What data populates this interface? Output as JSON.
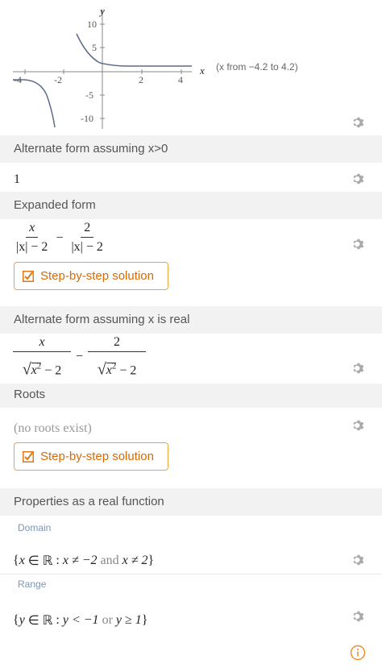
{
  "plot": {
    "x_axis_label": "x",
    "y_axis_label": "y",
    "x_ticks": [
      "-4",
      "-2",
      "2",
      "4"
    ],
    "y_ticks": [
      "10",
      "5",
      "-5",
      "-10"
    ],
    "range_note": "(x from −4.2 to 4.2)"
  },
  "sections": {
    "alt_form_pos": "Alternate form assuming x>0",
    "alt_form_pos_value": "1",
    "expanded": "Expanded form",
    "alt_form_real": "Alternate form assuming x is real",
    "roots": "Roots",
    "roots_value": "(no roots exist)",
    "properties": "Properties as a real function",
    "domain": "Domain",
    "range": "Range"
  },
  "buttons": {
    "step_by_step_1": "Step-by-step solution",
    "step_by_step_2": "Step-by-step solution"
  },
  "expanded_math": {
    "num1": "x",
    "den1": "|x| − 2",
    "op": "−",
    "num2": "2",
    "den2": "|x| − 2"
  },
  "real_math": {
    "num1": "x",
    "num2": "2",
    "op": "−",
    "den_sq": "x",
    "den_pow": "2",
    "den_tail": "− 2"
  },
  "domain_math": {
    "open": "{",
    "var": "x",
    "in": "∈",
    "set": "ℝ",
    "colon": ":",
    "c1": "x ≠ −2",
    "and": "and",
    "c2": "x ≠ 2",
    "close": "}"
  },
  "range_math": {
    "open": "{",
    "var": "y",
    "in": "∈",
    "set": "ℝ",
    "colon": ":",
    "c1": "y < −1",
    "or": "or",
    "c2": "y ≥ 1",
    "close": "}"
  },
  "colors": {
    "accent": "#f2a23a",
    "button_text": "#d66a05",
    "header_bg": "#f2f2f2",
    "subheader": "#7a95b8",
    "icon": "#aaaaaa",
    "info": "#f28c28"
  },
  "icons": [
    "gear-icon",
    "checkbox-icon",
    "info-icon"
  ]
}
